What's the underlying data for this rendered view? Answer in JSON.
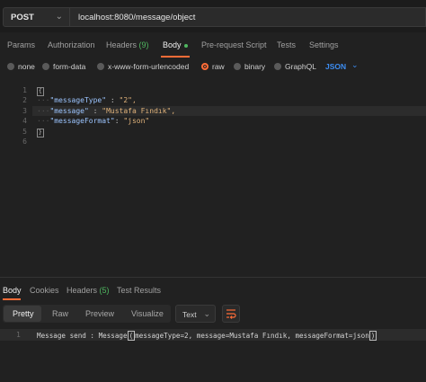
{
  "request": {
    "method": "POST",
    "url": "localhost:8080/message/object"
  },
  "request_tabs": {
    "params": "Params",
    "authorization": "Authorization",
    "headers": "Headers",
    "headers_count": "(9)",
    "body": "Body",
    "pre_request": "Pre-request Script",
    "tests": "Tests",
    "settings": "Settings"
  },
  "body_types": {
    "none": "none",
    "form_data": "form-data",
    "urlencoded": "x-www-form-urlencoded",
    "raw": "raw",
    "binary": "binary",
    "graphql": "GraphQL",
    "selected": "raw",
    "format": "JSON"
  },
  "editor": {
    "line_numbers": [
      "1",
      "2",
      "3",
      "4",
      "5",
      "6"
    ],
    "fields": [
      {
        "key": "\"messageType\"",
        "sep": " : ",
        "value": "\"2\","
      },
      {
        "key": "\"message\"",
        "sep": " : ",
        "value": "\"Mustafa Fındık\","
      },
      {
        "key": "\"messageFormat\"",
        "sep": ": ",
        "value": "\"json\""
      }
    ],
    "open_brace": "{",
    "close_brace": "}"
  },
  "response_tabs": {
    "body": "Body",
    "cookies": "Cookies",
    "headers": "Headers",
    "headers_count": "(5)",
    "test_results": "Test Results"
  },
  "response_view": {
    "pretty": "Pretty",
    "raw": "Raw",
    "preview": "Preview",
    "visualize": "Visualize",
    "format": "Text"
  },
  "response": {
    "line_number": "1",
    "prefix": "Message send : Message",
    "inner": "messageType=2, message=Mustafa Fındık, messageFormat=json",
    "open": "(",
    "close": ")"
  },
  "colors": {
    "accent": "#ff6c37",
    "badge_green": "#4fb760",
    "json_blue": "#3c8df3"
  }
}
